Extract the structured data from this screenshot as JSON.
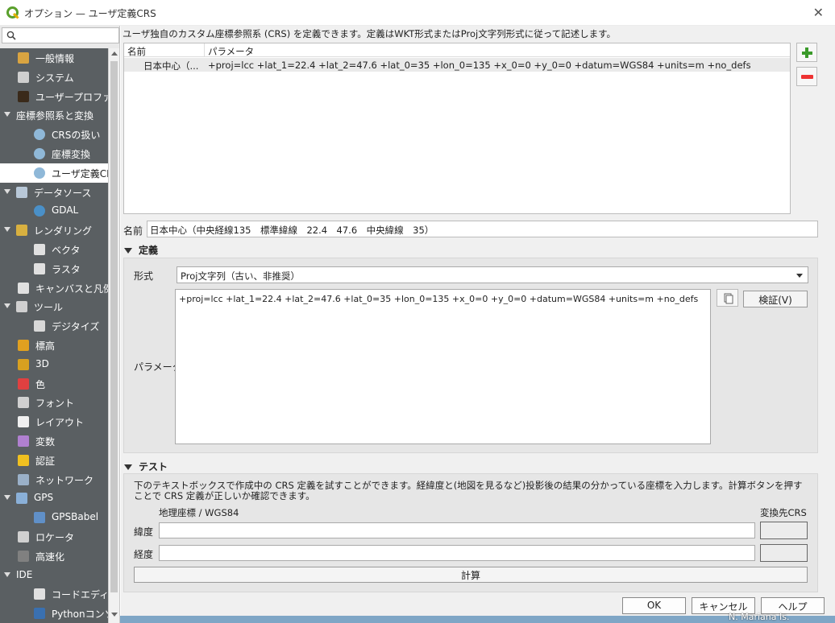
{
  "window": {
    "title": "オプション — ユーザ定義CRS",
    "close": "✕"
  },
  "sidebar": {
    "search_placeholder": "",
    "items": [
      {
        "label": "一般情報",
        "icon": "tools-icon",
        "indent": 1
      },
      {
        "label": "システム",
        "icon": "gear-icon",
        "indent": 1
      },
      {
        "label": "ユーザープロファイル",
        "icon": "user-icon",
        "indent": 1
      },
      {
        "label": "座標参照系と変換",
        "icon": "",
        "indent": 0,
        "expanded": true
      },
      {
        "label": "CRSの扱い",
        "icon": "globe-icon",
        "indent": 2
      },
      {
        "label": "座標変換",
        "icon": "globe-transform-icon",
        "indent": 2
      },
      {
        "label": "ユーザ定義CRS",
        "icon": "globe-custom-icon",
        "indent": 2,
        "selected": true
      },
      {
        "label": "データソース",
        "icon": "table-icon",
        "indent": 0,
        "expanded": true
      },
      {
        "label": "GDAL",
        "icon": "gdal-globe-icon",
        "indent": 2
      },
      {
        "label": "レンダリング",
        "icon": "brush-icon",
        "indent": 0,
        "expanded": true
      },
      {
        "label": "ベクタ",
        "icon": "vector-icon",
        "indent": 2
      },
      {
        "label": "ラスタ",
        "icon": "raster-icon",
        "indent": 2
      },
      {
        "label": "キャンバスと凡例",
        "icon": "canvas-icon",
        "indent": 1
      },
      {
        "label": "ツール",
        "icon": "toolbox-icon",
        "indent": 0,
        "expanded": true
      },
      {
        "label": "デジタイズ",
        "icon": "digitize-icon",
        "indent": 2
      },
      {
        "label": "標高",
        "icon": "elevation-icon",
        "indent": 1
      },
      {
        "label": "3D",
        "icon": "cube-3d-icon",
        "indent": 1
      },
      {
        "label": "色",
        "icon": "color-grid-icon",
        "indent": 1
      },
      {
        "label": "フォント",
        "icon": "font-icon",
        "indent": 1
      },
      {
        "label": "レイアウト",
        "icon": "layout-icon",
        "indent": 1
      },
      {
        "label": "変数",
        "icon": "variable-icon",
        "indent": 1
      },
      {
        "label": "認証",
        "icon": "lock-icon",
        "indent": 1
      },
      {
        "label": "ネットワーク",
        "icon": "network-icon",
        "indent": 1
      },
      {
        "label": "GPS",
        "icon": "gps-icon",
        "indent": 0,
        "expanded": true
      },
      {
        "label": "GPSBabel",
        "icon": "gpsbabel-icon",
        "indent": 2
      },
      {
        "label": "ロケータ",
        "icon": "locator-icon",
        "indent": 1
      },
      {
        "label": "高速化",
        "icon": "acceleration-icon",
        "indent": 1
      },
      {
        "label": "IDE",
        "icon": "",
        "indent": 0,
        "expanded": true
      },
      {
        "label": "コードエディタ",
        "icon": "code-editor-icon",
        "indent": 2
      },
      {
        "label": "Pythonコンソール",
        "icon": "python-icon",
        "indent": 2
      }
    ]
  },
  "intro": "ユーザ独自のカスタム座標参照系 (CRS) を定義できます。定義はWKT形式またはProj文字列形式に従って記述します。",
  "crs_table": {
    "headers": [
      "名前",
      "パラメータ"
    ],
    "rows": [
      {
        "name": "日本中心（...",
        "params": "+proj=lcc +lat_1=22.4 +lat_2=47.6 +lat_0=35 +lon_0=135 +x_0=0 +y_0=0 +datum=WGS84 +units=m +no_defs"
      }
    ]
  },
  "name": {
    "label": "名前",
    "value": "日本中心（中央経線135　標準緯線　22.4　47.6　中央緯線　35）"
  },
  "definition": {
    "section_title": "定義",
    "format_label": "形式",
    "format_value": "Proj文字列（古い、非推奨）",
    "params_label": "パラメータ",
    "params_value": "+proj=lcc +lat_1=22.4 +lat_2=47.6 +lat_0=35 +lon_0=135 +x_0=0 +y_0=0 +datum=WGS84 +units=m +no_defs",
    "validate_label": "検証(V)"
  },
  "test": {
    "section_title": "テスト",
    "description": "下のテキストボックスで作成中の CRS 定義を試すことができます。経緯度と(地図を見るなど)投影後の結果の分かっている座標を入力します。計算ボタンを押すことで CRS 定義が正しいか確認できます。",
    "geo_label": "地理座標 / WGS84",
    "dest_label": "変換先CRS",
    "lat_label": "緯度",
    "lon_label": "経度",
    "lat_value": "",
    "lon_value": "",
    "calc_label": "計算"
  },
  "buttons": {
    "ok": "OK",
    "cancel": "キャンセル",
    "help": "ヘルプ"
  },
  "background_map_label": "N. Mariana Is."
}
